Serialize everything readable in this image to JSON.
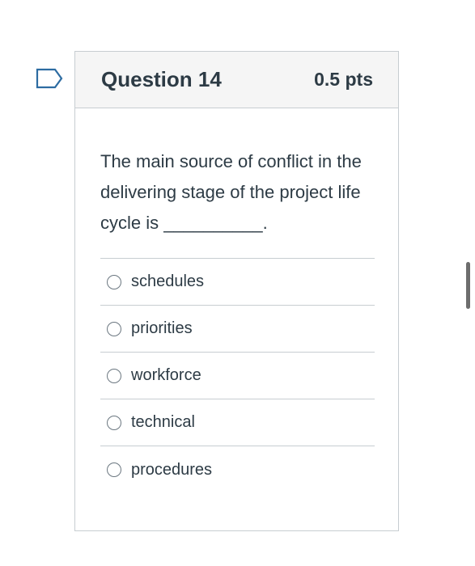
{
  "flag": {
    "icon": "flag-question-icon",
    "color": "#2d6ca2"
  },
  "question": {
    "title": "Question 14",
    "points": "0.5 pts",
    "text": "The main source of conflict in the delivering stage of the project life cycle is __________.",
    "answers": [
      {
        "label": "schedules",
        "selected": false
      },
      {
        "label": "priorities",
        "selected": false
      },
      {
        "label": "workforce",
        "selected": false
      },
      {
        "label": "technical",
        "selected": false
      },
      {
        "label": "procedures",
        "selected": false
      }
    ]
  }
}
